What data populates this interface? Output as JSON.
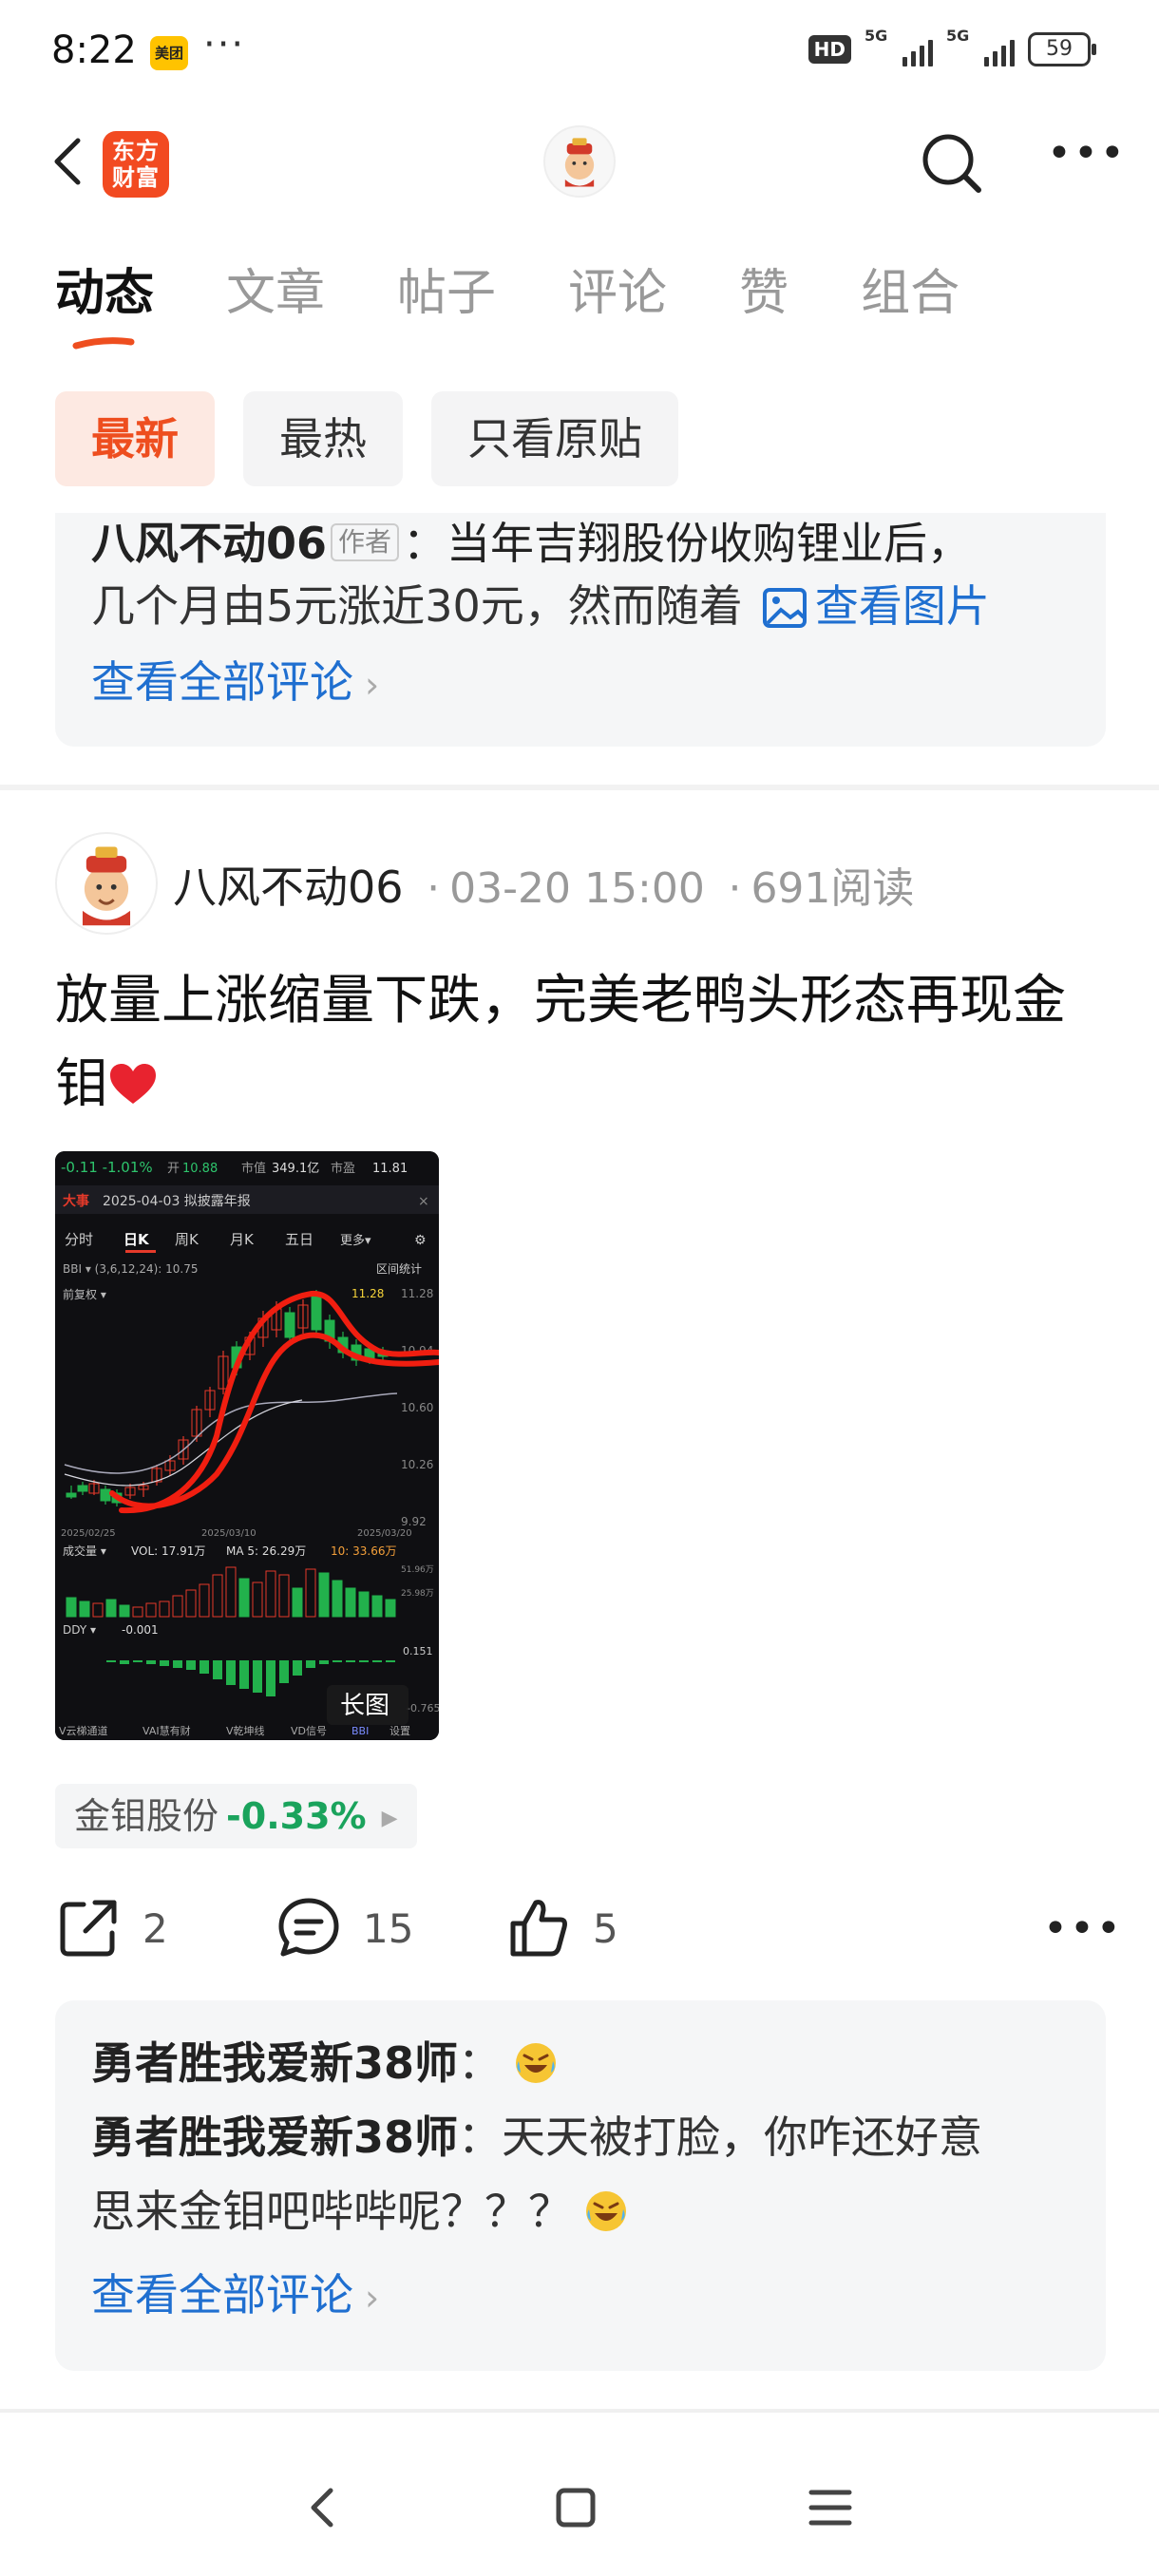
{
  "status_bar": {
    "time": "8:22",
    "app_badge": "美团",
    "dots": "···",
    "hd_badge": "HD",
    "network_1": "5G",
    "network_2": "5G",
    "battery": "59"
  },
  "header": {
    "app_logo_text": "东方财富",
    "icons": [
      "back-icon",
      "avatar",
      "search-icon",
      "more-icon"
    ]
  },
  "tabs": [
    "动态",
    "文章",
    "帖子",
    "评论",
    "赞",
    "组合"
  ],
  "active_tab": "动态",
  "filters": [
    "最新",
    "最热",
    "只看原贴"
  ],
  "active_filter": "最新",
  "comment_card_1": {
    "author": "八风不动06",
    "author_tag": "作者",
    "text_line1": "：当年吉翔股份收购锂业后，",
    "text_line2": "几个月由5元涨近30元，然而随着",
    "view_image": "查看图片",
    "view_all": "查看全部评论"
  },
  "post": {
    "author": "八风不动06",
    "sep": "·",
    "date": "03-20 15:00",
    "reads": "691阅读",
    "title": "放量上涨缩量下跌，完美老鸭头形态再现金钼",
    "image_badge": "长图",
    "stock_name": "金钼股份",
    "stock_change": "-0.33%",
    "actions": {
      "share_count": "2",
      "comment_count": "15",
      "like_count": "5"
    }
  },
  "chart_image": {
    "top_bar": {
      "change": "-0.11  -1.01%",
      "open_label": "开",
      "open": "10.88",
      "mcap_label": "市值",
      "mcap": "349.1亿",
      "pe_label": "市盈",
      "pe": "11.81"
    },
    "event_badge": "大事",
    "event_text": "2025-04-03 拟披露年报",
    "periods": [
      "分时",
      "日K",
      "周K",
      "月K",
      "五日",
      "更多▾"
    ],
    "active_period": "日K",
    "indicator_line": "BBI ▾  (3,6,12,24):  10.75",
    "range_stats": "区间统计",
    "fq": "前复权 ▾",
    "high_label": "11.28",
    "price_ticks": [
      "11.28",
      "10.94",
      "10.60",
      "10.26",
      "9.92"
    ],
    "date_start": "2025/02/25",
    "date_mid": "2025/03/10",
    "date_end": "2025/03/20",
    "vol_line_label": "成交量 ▾",
    "vol": "VOL: 17.91万",
    "ma5": "MA 5: 26.29万",
    "ma10": "10: 33.66万",
    "vol_ticks": [
      "51.96万",
      "25.98万"
    ],
    "ddy_label": "DDY ▾",
    "ddy_value": "-0.001",
    "ddy_tick_top": "0.151",
    "ddy_tick_bottom": "-0.765",
    "bottom_tabs": [
      "V云梯通道",
      "VAI慧有财",
      "V乾坤线",
      "VD信号",
      "BBI",
      "设置"
    ]
  },
  "comment_card_2": {
    "author": "勇者胜我爱新38师",
    "line1_suffix": "：",
    "line2_author": "勇者胜我爱新38师",
    "line2_text": "：天天被打脸，你咋还好意",
    "line3_text": "思来金钼吧哔哔呢？？？",
    "view_all": "查看全部评论"
  },
  "colors": {
    "accent_orange": "#ee4e1f",
    "link_blue": "#1f6fd0",
    "down_green": "#1aa35c",
    "heart_red": "#e8232f"
  }
}
